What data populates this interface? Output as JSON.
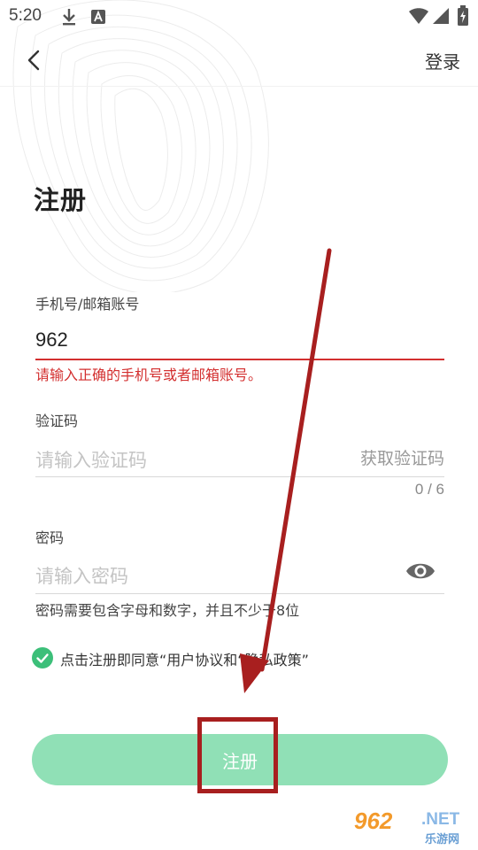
{
  "status_bar": {
    "time": "5:20",
    "icons": [
      "download-icon",
      "a-badge-icon",
      "wifi-icon",
      "signal-icon",
      "battery-icon"
    ]
  },
  "nav": {
    "back_icon": "chevron-left-icon",
    "login_label": "登录"
  },
  "page": {
    "title": "注册"
  },
  "form": {
    "account": {
      "label": "手机号/邮箱账号",
      "value": "962",
      "error": "请输入正确的手机号或者邮箱账号。"
    },
    "code": {
      "label": "验证码",
      "placeholder": "请输入验证码",
      "get_code_label": "获取验证码",
      "counter": "0 / 6"
    },
    "password": {
      "label": "密码",
      "placeholder": "请输入密码",
      "hint": "密码需要包含字母和数字，并且不少于8位",
      "visibility_icon": "eye-icon"
    }
  },
  "agreement": {
    "checked": true,
    "text": "点击注册即同意“用户协议和“隐私政策”"
  },
  "register_button": {
    "label": "注册"
  },
  "watermark": {
    "logo": "962",
    "net": ".NET",
    "sub": "乐游网"
  },
  "colors": {
    "accent": "#3cbf79",
    "button": "#90e0b6",
    "error": "#d32f2f",
    "annotation": "#a81f1f"
  }
}
